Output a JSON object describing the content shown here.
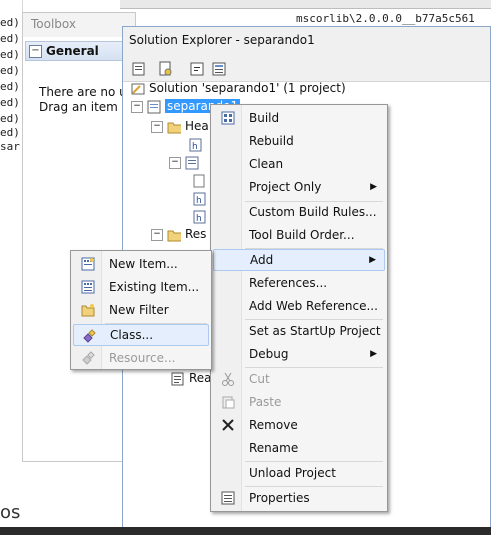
{
  "background": {
    "editor_lines": [
      "ed) :",
      "ed) :",
      "ed) :",
      "ed) :",
      "ed) :",
      "ed) :",
      "ed) :",
      "ed) :",
      "sar"
    ],
    "path_text": "mscorlib\\2.0.0.0__b77a5c561",
    "bottom_text": "os"
  },
  "toolbox": {
    "title": "Toolbox",
    "group_label": "General",
    "group_toggle": "−",
    "message_line1": "There are no us",
    "message_line2": "Drag an item or"
  },
  "solution_explorer": {
    "title": "Solution Explorer - separando1",
    "solution_node": "Solution 'separando1' (1 project)",
    "project_node": "separando1",
    "tree_labels": {
      "headers": "Hea",
      "resources": "Res",
      "readme": "Rea"
    }
  },
  "project_menu": {
    "items": [
      {
        "label": "Build",
        "icon": "build-icon"
      },
      {
        "label": "Rebuild"
      },
      {
        "label": "Clean"
      },
      {
        "label": "Project Only",
        "submenu": true
      },
      {
        "label": "Custom Build Rules..."
      },
      {
        "label": "Tool Build Order..."
      },
      {
        "label": "Add",
        "submenu": true,
        "highlighted": true
      },
      {
        "label": "References..."
      },
      {
        "label": "Add Web Reference..."
      },
      {
        "label": "Set as StartUp Project"
      },
      {
        "label": "Debug",
        "submenu": true
      },
      {
        "label": "Cut",
        "disabled": true,
        "icon": "scissors-icon"
      },
      {
        "label": "Paste",
        "disabled": true,
        "icon": "paste-icon"
      },
      {
        "label": "Remove",
        "icon": "remove-x-icon"
      },
      {
        "label": "Rename"
      },
      {
        "label": "Unload Project"
      },
      {
        "label": "Properties",
        "icon": "properties-icon"
      }
    ],
    "arrow": "▶"
  },
  "add_submenu": {
    "items": [
      {
        "label": "New Item...",
        "icon": "new-item-icon"
      },
      {
        "label": "Existing Item...",
        "icon": "existing-item-icon"
      },
      {
        "label": "New Filter",
        "icon": "new-filter-icon"
      },
      {
        "label": "Class...",
        "icon": "class-icon",
        "highlighted": true
      },
      {
        "label": "Resource...",
        "icon": "resource-icon",
        "disabled": true
      }
    ]
  },
  "colors": {
    "selection": "#3399ff",
    "menu_highlight": "#e4eefc",
    "menu_highlight_border": "#aec9ee",
    "window_border": "#8aa6c8"
  }
}
